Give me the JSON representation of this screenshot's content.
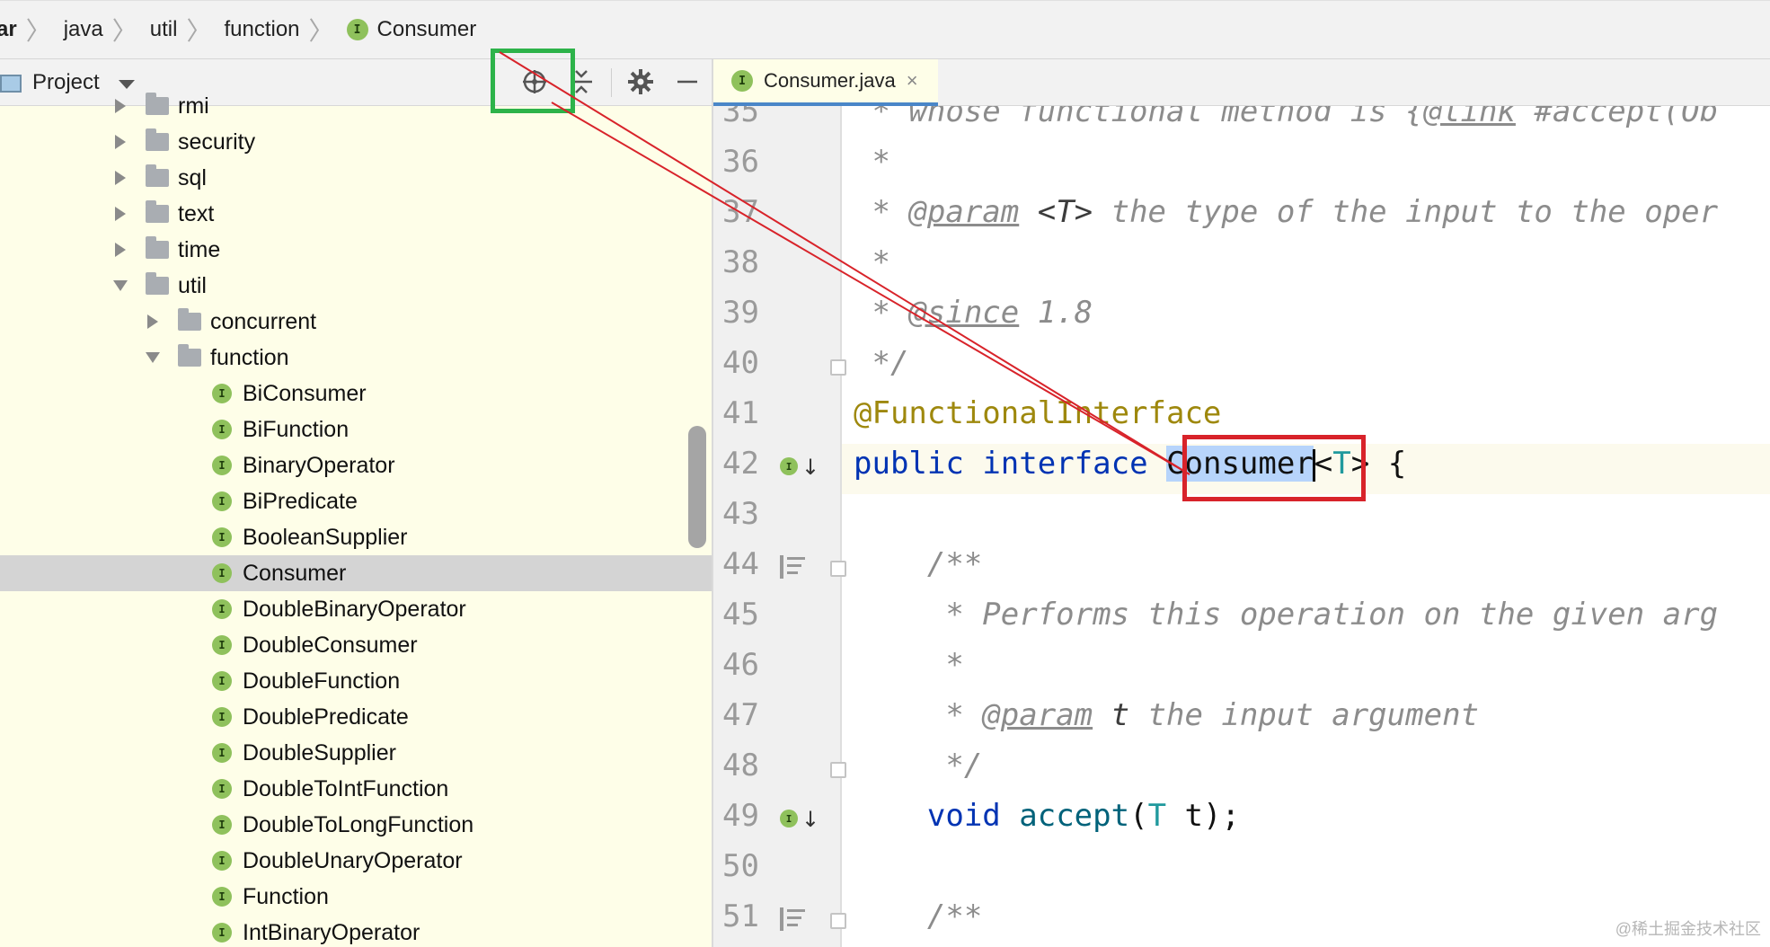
{
  "breadcrumb": {
    "items": [
      "ar",
      "java",
      "util",
      "function",
      "Consumer"
    ],
    "current_badge": "I"
  },
  "project": {
    "title": "Project",
    "toolbar_icons": [
      "locate-icon",
      "collapse-icon",
      "gear-icon",
      "minimize-icon"
    ],
    "tree": [
      {
        "label": "rmi",
        "type": "folder",
        "level": 1,
        "state": "collapsed"
      },
      {
        "label": "security",
        "type": "folder",
        "level": 1,
        "state": "collapsed"
      },
      {
        "label": "sql",
        "type": "folder",
        "level": 1,
        "state": "collapsed"
      },
      {
        "label": "text",
        "type": "folder",
        "level": 1,
        "state": "collapsed"
      },
      {
        "label": "time",
        "type": "folder",
        "level": 1,
        "state": "collapsed"
      },
      {
        "label": "util",
        "type": "folder",
        "level": 1,
        "state": "expanded"
      },
      {
        "label": "concurrent",
        "type": "folder",
        "level": 2,
        "state": "collapsed"
      },
      {
        "label": "function",
        "type": "folder",
        "level": 2,
        "state": "expanded"
      },
      {
        "label": "BiConsumer",
        "type": "interface",
        "level": 3
      },
      {
        "label": "BiFunction",
        "type": "interface",
        "level": 3
      },
      {
        "label": "BinaryOperator",
        "type": "interface",
        "level": 3
      },
      {
        "label": "BiPredicate",
        "type": "interface",
        "level": 3
      },
      {
        "label": "BooleanSupplier",
        "type": "interface",
        "level": 3
      },
      {
        "label": "Consumer",
        "type": "interface",
        "level": 3,
        "selected": true
      },
      {
        "label": "DoubleBinaryOperator",
        "type": "interface",
        "level": 3
      },
      {
        "label": "DoubleConsumer",
        "type": "interface",
        "level": 3
      },
      {
        "label": "DoubleFunction",
        "type": "interface",
        "level": 3
      },
      {
        "label": "DoublePredicate",
        "type": "interface",
        "level": 3
      },
      {
        "label": "DoubleSupplier",
        "type": "interface",
        "level": 3
      },
      {
        "label": "DoubleToIntFunction",
        "type": "interface",
        "level": 3
      },
      {
        "label": "DoubleToLongFunction",
        "type": "interface",
        "level": 3
      },
      {
        "label": "DoubleUnaryOperator",
        "type": "interface",
        "level": 3
      },
      {
        "label": "Function",
        "type": "interface",
        "level": 3
      },
      {
        "label": "IntBinaryOperator",
        "type": "interface",
        "level": 3
      }
    ]
  },
  "editor": {
    "tab": {
      "label": "Consumer.java",
      "close": "×",
      "badge": "I"
    },
    "line_numbers": [
      "35",
      "36",
      "37",
      "38",
      "39",
      "40",
      "41",
      "42",
      "43",
      "44",
      "45",
      "46",
      "47",
      "48",
      "49",
      "50",
      "51"
    ],
    "code": {
      "l35_star": " * ",
      "l35_text": "whose functional method is {",
      "l35_link": "@link",
      "l35_rest": " #accept(Ob",
      "l36": " *",
      "l37_star": " * ",
      "l37_tag": "@param",
      "l37_val": " <T>",
      "l37_rest": " the type of the input to the oper",
      "l38": " *",
      "l39_star": " * ",
      "l39_tag": "@since",
      "l39_val": " 1.8",
      "l40": " */",
      "l41": "@FunctionalInterface",
      "l42_kw1": "public",
      "l42_sp1": " ",
      "l42_kw2": "interface",
      "l42_sp2": " ",
      "l42_name": "Consumer",
      "l42_lt": "<",
      "l42_T": "T",
      "l42_rest": "> {",
      "l44": "    /**",
      "l45": "     * Performs this operation on the given arg",
      "l46": "     *",
      "l47_star": "     * ",
      "l47_tag": "@param",
      "l47_val": " t",
      "l47_rest": " the input argument",
      "l48": "     */",
      "l49_indent": "    ",
      "l49_kw": "void",
      "l49_sp": " ",
      "l49_m": "accept",
      "l49_p1": "(",
      "l49_T": "T",
      "l49_rest": " t);",
      "l51": "    /**"
    }
  },
  "watermark": "@稀土掘金技术社区",
  "colors": {
    "annotation_highlight_green": "#2db34a",
    "annotation_highlight_red": "#d8232a",
    "selection": "#b7d4fb"
  }
}
